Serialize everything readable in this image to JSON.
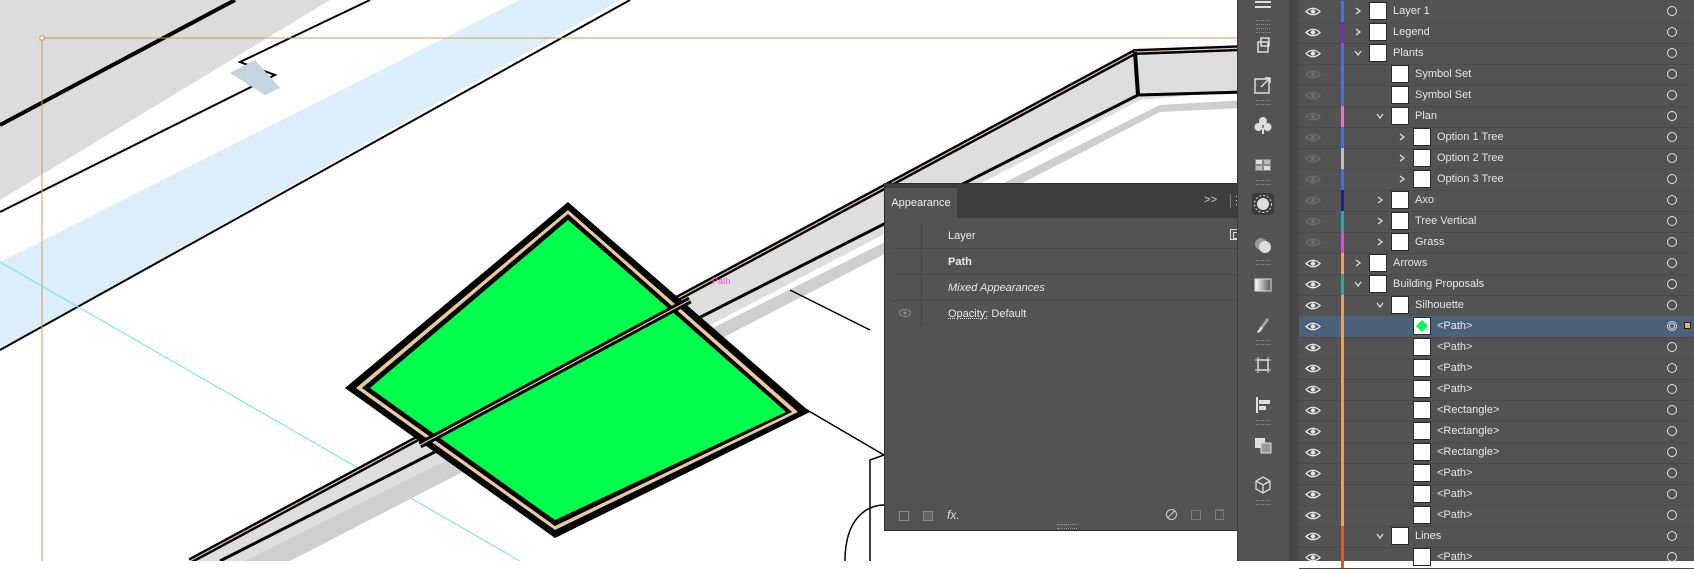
{
  "canvas": {
    "path_hint_label": "Path",
    "fill_color": "#00ff4c"
  },
  "appearance": {
    "tab_label": "Appearance",
    "collapse_label": ">>",
    "rows": {
      "layer": "Layer",
      "path": "Path",
      "mixed": "Mixed Appearances",
      "opacity_label": "Opacity:",
      "opacity_value": "Default"
    },
    "footer": {
      "fx_label": "fx."
    }
  },
  "layers": {
    "rows": [
      {
        "name": "Layer 1",
        "color": "#4a6fe0",
        "level": 0,
        "chevron": ">",
        "visible": true
      },
      {
        "name": "Legend",
        "color": "#7a2bb8",
        "level": 0,
        "chevron": ">",
        "visible": true
      },
      {
        "name": "Plants",
        "color": "#4a6fe0",
        "level": 0,
        "chevron": "v",
        "visible": true
      },
      {
        "name": "Symbol Set",
        "color": "#4a6fe0",
        "level": 1,
        "chevron": "",
        "visible": false
      },
      {
        "name": "Symbol Set",
        "color": "#4a6fe0",
        "level": 1,
        "chevron": "",
        "visible": false
      },
      {
        "name": "Plan",
        "color": "#e878b8",
        "level": 1,
        "chevron": "v",
        "visible": false
      },
      {
        "name": "Option 1 Tree",
        "color": "#4a6fe0",
        "level": 2,
        "chevron": ">",
        "visible": false
      },
      {
        "name": "Option 2 Tree",
        "color": "#c0c0c0",
        "level": 2,
        "chevron": ">",
        "visible": false
      },
      {
        "name": "Option 3 Tree",
        "color": "#4a6fe0",
        "level": 2,
        "chevron": ">",
        "visible": false
      },
      {
        "name": "Axo",
        "color": "#1e1e8c",
        "level": 1,
        "chevron": ">",
        "visible": false
      },
      {
        "name": "Tree Vertical",
        "color": "#2aa8a0",
        "level": 1,
        "chevron": ">",
        "visible": false
      },
      {
        "name": "Grass",
        "color": "#d44fd8",
        "level": 1,
        "chevron": ">",
        "visible": false
      },
      {
        "name": "Arrows",
        "color": "#e8a060",
        "level": 0,
        "chevron": ">",
        "visible": true
      },
      {
        "name": "Building Proposals",
        "color": "#2aa8a0",
        "level": 0,
        "chevron": "v",
        "visible": true
      },
      {
        "name": "Silhouette",
        "color": "#e8a060",
        "level": 1,
        "chevron": "v",
        "visible": true
      },
      {
        "name": "<Path>",
        "color": "#e8a060",
        "level": 2,
        "chevron": "",
        "visible": true,
        "selected": true
      },
      {
        "name": "<Path>",
        "color": "#e8a060",
        "level": 2,
        "chevron": "",
        "visible": true
      },
      {
        "name": "<Path>",
        "color": "#e8a060",
        "level": 2,
        "chevron": "",
        "visible": true
      },
      {
        "name": "<Path>",
        "color": "#e8a060",
        "level": 2,
        "chevron": "",
        "visible": true
      },
      {
        "name": "<Rectangle>",
        "color": "#e8a060",
        "level": 2,
        "chevron": "",
        "visible": true
      },
      {
        "name": "<Rectangle>",
        "color": "#e8a060",
        "level": 2,
        "chevron": "",
        "visible": true
      },
      {
        "name": "<Rectangle>",
        "color": "#e8a060",
        "level": 2,
        "chevron": "",
        "visible": true
      },
      {
        "name": "<Path>",
        "color": "#e8a060",
        "level": 2,
        "chevron": "",
        "visible": true
      },
      {
        "name": "<Path>",
        "color": "#e8a060",
        "level": 2,
        "chevron": "",
        "visible": true
      },
      {
        "name": "<Path>",
        "color": "#e8a060",
        "level": 2,
        "chevron": "",
        "visible": true
      },
      {
        "name": "Lines",
        "color": "#e05a30",
        "level": 1,
        "chevron": "v",
        "visible": true
      },
      {
        "name": "<Path>",
        "color": "#e05a30",
        "level": 2,
        "chevron": "",
        "visible": true
      }
    ]
  }
}
